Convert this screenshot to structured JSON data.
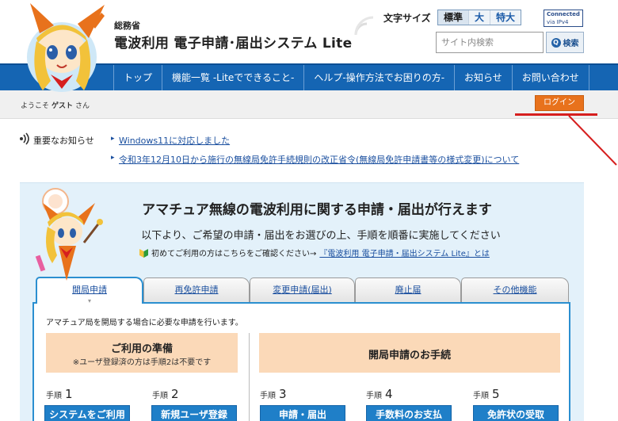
{
  "header": {
    "ministry": "総務省",
    "site_title": "電波利用 電子申請･届出システム Lite",
    "font_size_label": "文字サイズ",
    "font_size_options": [
      "標準",
      "大",
      "特大"
    ],
    "font_size_selected": "標準",
    "ipv4_line1": "Connected",
    "ipv4_line2": "via IPv4",
    "search_placeholder": "サイト内検索",
    "search_button": "検索",
    "search_icon_glyph": "Q"
  },
  "nav": {
    "items": [
      "トップ",
      "機能一覧 -Liteでできること-",
      "ヘルプ-操作方法でお困りの方-",
      "お知らせ",
      "お問い合わせ"
    ]
  },
  "welcome": {
    "prefix": "ようこそ",
    "user": "ゲスト",
    "suffix": "さん",
    "login_button": "ログイン"
  },
  "notices": {
    "label": "重要なお知らせ",
    "items": [
      "Windows11に対応しました",
      "令和3年12月10日から施行の無線局免許手続規則の改正省令(無線局免許申請書等の様式変更)について"
    ]
  },
  "main": {
    "title": "アマチュア無線の電波利用に関する申請・届出が行えます",
    "subtitle": "以下より、ご希望の申請・届出をお選びの上、手順を順番に実施してください",
    "beginner_text": "初めてご利用の方はこちらをご確認ください→",
    "beginner_link": "『電波利用 電子申請・届出システム Lite』とは"
  },
  "tabs": [
    {
      "label": "開局申請",
      "active": true
    },
    {
      "label": "再免許申請",
      "active": false
    },
    {
      "label": "変更申請(届出)",
      "active": false
    },
    {
      "label": "廃止届",
      "active": false
    },
    {
      "label": "その他機能",
      "active": false
    }
  ],
  "tab_content": {
    "description": "アマチュア局を開局する場合に必要な申請を行います。",
    "prep_title": "ご利用の準備",
    "prep_note": "※ユーザ登録済の方は手順2は不要です",
    "open_title": "開局申請のお手続",
    "step_word": "手順",
    "steps": [
      {
        "num": "1",
        "button": "システムをご利用"
      },
      {
        "num": "2",
        "button": "新規ユーザ登録"
      },
      {
        "num": "3",
        "button": "申請・届出"
      },
      {
        "num": "4",
        "button": "手数料のお支払"
      },
      {
        "num": "5",
        "button": "免許状の受取"
      }
    ]
  },
  "colors": {
    "nav_blue": "#1565b3",
    "login_orange": "#e8721c",
    "panel_blue": "#e3f1fa",
    "step_blue": "#1f7fc8",
    "prep_peach": "#fbd9b8",
    "annotation_red": "#d61f1f"
  }
}
